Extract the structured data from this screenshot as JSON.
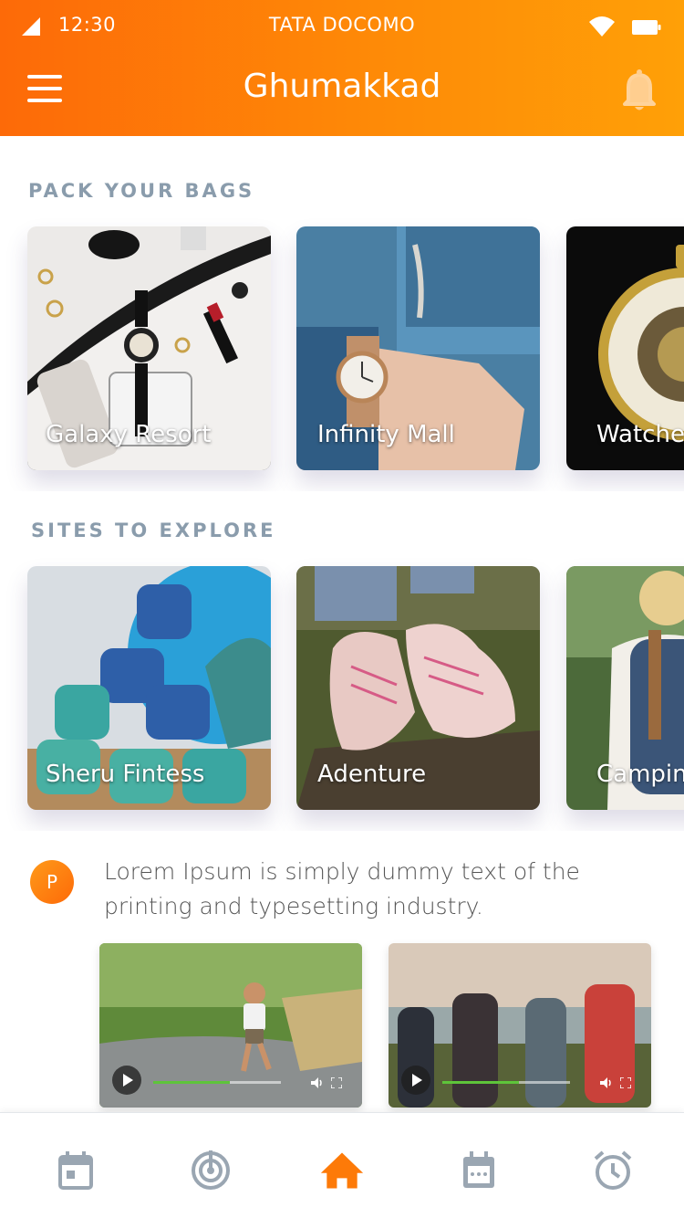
{
  "status_bar": {
    "time": "12:30",
    "carrier": "TATA DOCOMO",
    "icons": [
      "signal-icon",
      "wifi-icon",
      "battery-icon"
    ]
  },
  "header": {
    "title": "Ghumakkad",
    "menu_icon": "hamburger-menu-icon",
    "notification_icon": "bell-icon"
  },
  "sections": [
    {
      "title": "PACK YOUR BAGS",
      "cards": [
        {
          "label": "Galaxy Resort",
          "image": "flat-lay-accessories"
        },
        {
          "label": "Infinity Mall",
          "image": "wrist-watch-denim"
        },
        {
          "label": "Watcher",
          "image": "pocket-watch"
        }
      ]
    },
    {
      "title": "SITES TO EXPLORE",
      "cards": [
        {
          "label": "Sheru Fintess",
          "image": "dumbbells"
        },
        {
          "label": "Adenture",
          "image": "sneakers-on-log"
        },
        {
          "label": "Camping",
          "image": "hiker-backpack"
        }
      ]
    }
  ],
  "post": {
    "avatar_letter": "P",
    "text": "Lorem Ipsum is simply dummy text of the printing and typesetting industry.",
    "videos": [
      {
        "image": "running-boy",
        "progress": 0.6
      },
      {
        "image": "hiking-group",
        "progress": 0.6
      }
    ]
  },
  "bottom_nav": [
    {
      "icon": "calendar-icon",
      "active": false
    },
    {
      "icon": "radar-icon",
      "active": false
    },
    {
      "icon": "home-icon",
      "active": true
    },
    {
      "icon": "calendar-dots-icon",
      "active": false
    },
    {
      "icon": "alarm-clock-icon",
      "active": false
    }
  ],
  "colors": {
    "header_start": "#fd6a08",
    "header_end": "#ffa007",
    "section_title": "#8a9cac",
    "active_nav": "#fd7a08",
    "inactive_nav": "#9aa6b2",
    "progress": "#5ec43a"
  }
}
